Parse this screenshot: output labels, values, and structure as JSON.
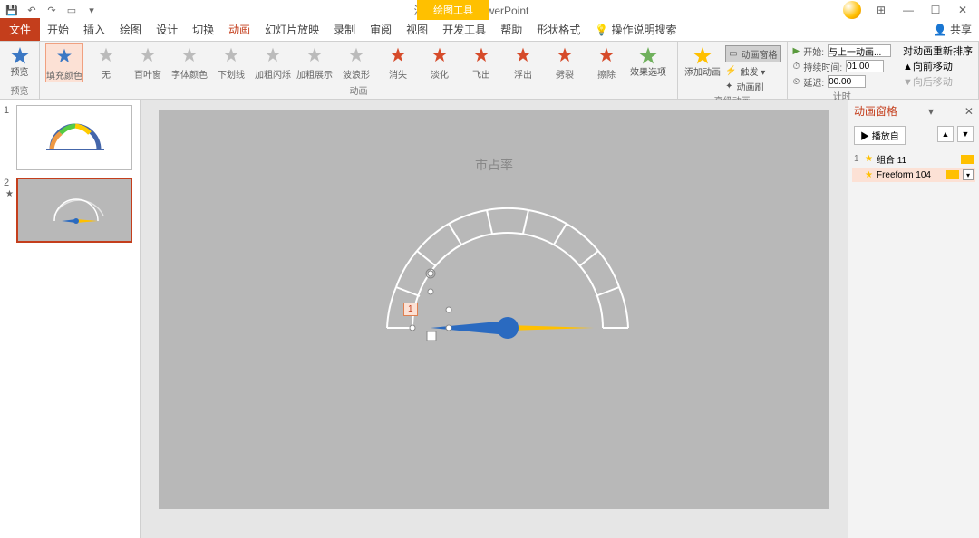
{
  "title": "演示文稿1 - PowerPoint",
  "contextualTab": "绘图工具",
  "tabs": {
    "file": "文件",
    "items": [
      "开始",
      "插入",
      "绘图",
      "设计",
      "切换",
      "动画",
      "幻灯片放映",
      "录制",
      "审阅",
      "视图",
      "开发工具",
      "帮助",
      "形状格式"
    ],
    "activeIndex": 5,
    "tellme": "操作说明搜索",
    "share": "共享"
  },
  "ribbon": {
    "preview": {
      "label": "预览",
      "btn": "预览"
    },
    "effects": [
      {
        "label": "填充颜色",
        "cls": "star-blue",
        "selected": true
      },
      {
        "label": "无",
        "cls": "star-gray"
      },
      {
        "label": "百叶窗",
        "cls": "star-gray"
      },
      {
        "label": "字体颜色",
        "cls": "star-gray"
      },
      {
        "label": "下划线",
        "cls": "star-gray"
      },
      {
        "label": "加粗闪烁",
        "cls": "star-gray"
      },
      {
        "label": "加粗展示",
        "cls": "star-gray"
      },
      {
        "label": "波浪形",
        "cls": "star-gray"
      },
      {
        "label": "消失",
        "cls": "star-red"
      },
      {
        "label": "淡化",
        "cls": "star-red"
      },
      {
        "label": "飞出",
        "cls": "star-red"
      },
      {
        "label": "浮出",
        "cls": "star-red"
      },
      {
        "label": "劈裂",
        "cls": "star-red"
      },
      {
        "label": "擦除",
        "cls": "star-red"
      }
    ],
    "effectsGroup": "动画",
    "effectOptions": "效果选项",
    "addAnim": "添加动画",
    "adv": {
      "pane": "动画窗格",
      "trigger": "触发 ▾",
      "painter": "动画刷"
    },
    "advGroup": "高级动画",
    "timing": {
      "start": "开始:",
      "startVal": "与上一动画...",
      "duration": "持续时间:",
      "durationVal": "01.00",
      "delay": "延迟:",
      "delayVal": "00.00",
      "group": "计时"
    },
    "reorder": {
      "label": "对动画重新排序",
      "fwd": "向前移动",
      "back": "向后移动"
    }
  },
  "slides": [
    {
      "n": "1",
      "selected": false
    },
    {
      "n": "2",
      "selected": true,
      "star": "★"
    }
  ],
  "slideContent": {
    "title": "市占率",
    "animTag": "1"
  },
  "animPane": {
    "title": "动画窗格",
    "play": "播放自",
    "items": [
      {
        "n": "1",
        "name": "组合 11",
        "selected": false
      },
      {
        "n": "",
        "name": "Freeform 104",
        "selected": true
      }
    ]
  }
}
